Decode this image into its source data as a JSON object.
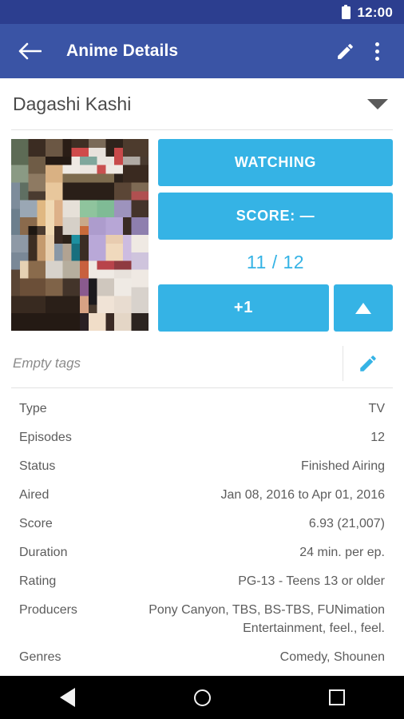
{
  "status_bar": {
    "time": "12:00",
    "battery_icon": "battery-full-icon"
  },
  "app_bar": {
    "back_icon": "arrow-back-icon",
    "title": "Anime Details",
    "edit_icon": "pencil-edit-icon",
    "overflow_icon": "more-vertical-icon"
  },
  "header": {
    "anime_title": "Dagashi Kashi",
    "dropdown_icon": "chevron-down-icon"
  },
  "hero": {
    "poster_alt": "anime-cover-art",
    "status_button": "WATCHING",
    "score_button": "SCORE: —",
    "progress": "11 / 12",
    "increment_button": "+1",
    "increment_icon": "caret-up-icon"
  },
  "tags": {
    "placeholder": "Empty tags",
    "edit_icon": "pencil-edit-icon"
  },
  "details": [
    {
      "label": "Type",
      "value": "TV"
    },
    {
      "label": "Episodes",
      "value": "12"
    },
    {
      "label": "Status",
      "value": "Finished Airing"
    },
    {
      "label": "Aired",
      "value": "Jan 08, 2016 to Apr 01, 2016"
    },
    {
      "label": "Score",
      "value": "6.93 (21,007)"
    },
    {
      "label": "Duration",
      "value": "24 min. per ep."
    },
    {
      "label": "Rating",
      "value": "PG-13 - Teens 13 or older"
    },
    {
      "label": "Producers",
      "value": "Pony Canyon, TBS, BS-TBS, FUNimation Entertainment, feel., feel."
    },
    {
      "label": "Genres",
      "value": "Comedy, Shounen"
    }
  ],
  "nav_bar": {
    "back": "nav-back-icon",
    "home": "nav-home-icon",
    "recents": "nav-recents-icon"
  },
  "colors": {
    "status_bar": "#2c3e8f",
    "app_bar": "#3a54a5",
    "accent": "#35b3e5",
    "text": "#5c5c5c",
    "nav_bar": "#000000"
  }
}
